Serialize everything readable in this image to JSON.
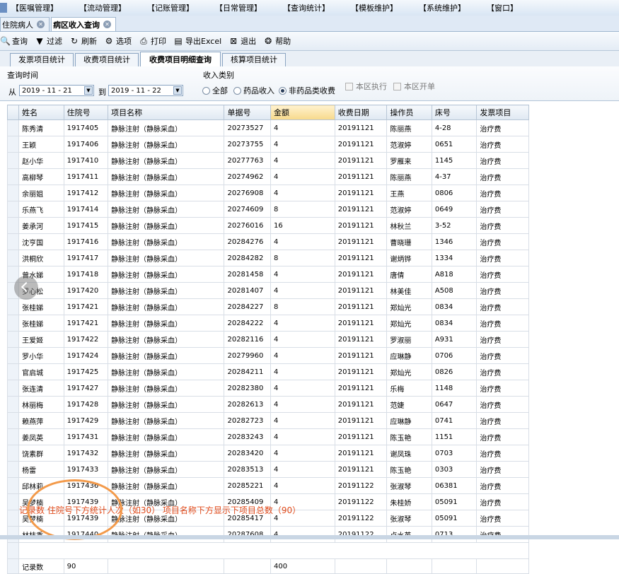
{
  "menu": [
    "【医嘱管理】",
    "【流动管理】",
    "【记账管理】",
    "【日常管理】",
    "【查询统计】",
    "【模板维护】",
    "【系统维护】",
    "【窗口】"
  ],
  "doc_tabs": [
    {
      "label": "住院病人",
      "active": false
    },
    {
      "label": "病区收入查询",
      "active": true
    }
  ],
  "toolbar": [
    {
      "label": "查询",
      "icon": "search-icon"
    },
    {
      "label": "过滤",
      "icon": "filter-icon"
    },
    {
      "label": "刷新",
      "icon": "refresh-icon"
    },
    {
      "label": "选项",
      "icon": "options-icon"
    },
    {
      "label": "打印",
      "icon": "print-icon"
    },
    {
      "label": "导出Excel",
      "icon": "export-excel-icon"
    },
    {
      "label": "退出",
      "icon": "exit-icon"
    },
    {
      "label": "帮助",
      "icon": "help-icon"
    }
  ],
  "sub_tabs": [
    {
      "label": "发票项目统计",
      "active": false
    },
    {
      "label": "收费项目统计",
      "active": false
    },
    {
      "label": "收费项目明细查询",
      "active": true
    },
    {
      "label": "核算项目统计",
      "active": false
    }
  ],
  "filter": {
    "time_label": "查询时间",
    "from_label": "从",
    "from_date": "2019 - 11 - 21",
    "to_label": "到",
    "to_date": "2019 - 11 - 22",
    "income_label": "收入类别",
    "options": [
      "全部",
      "药品收入",
      "非药品类收费"
    ],
    "selected": "非药品类收费",
    "check1": "本区执行",
    "check2": "本区开单"
  },
  "columns": [
    "姓名",
    "住院号",
    "项目名称",
    "单据号",
    "金额",
    "收费日期",
    "操作员",
    "床号",
    "发票项目"
  ],
  "rows": [
    [
      "陈秀清",
      "1917405",
      "静脉注射（静脉采血）",
      "20273527",
      "4",
      "20191121",
      "陈丽燕",
      "4-28",
      "治疗费"
    ],
    [
      "王颖",
      "1917406",
      "静脉注射（静脉采血）",
      "20273755",
      "4",
      "20191121",
      "范淑婷",
      "0651",
      "治疗费"
    ],
    [
      "赵小华",
      "1917410",
      "静脉注射（静脉采血）",
      "20277763",
      "4",
      "20191121",
      "罗雁来",
      "1145",
      "治疗费"
    ],
    [
      "高柳琴",
      "1917411",
      "静脉注射（静脉采血）",
      "20274962",
      "4",
      "20191121",
      "陈丽燕",
      "4-37",
      "治疗费"
    ],
    [
      "余丽姐",
      "1917412",
      "静脉注射（静脉采血）",
      "20276908",
      "4",
      "20191121",
      "王燕",
      "0806",
      "治疗费"
    ],
    [
      "乐燕飞",
      "1917414",
      "静脉注射（静脉采血）",
      "20274609",
      "8",
      "20191121",
      "范淑婷",
      "0649",
      "治疗费"
    ],
    [
      "姜承河",
      "1917415",
      "静脉注射（静脉采血）",
      "20276016",
      "16",
      "20191121",
      "林秋兰",
      "3-52",
      "治疗费"
    ],
    [
      "沈亨国",
      "1917416",
      "静脉注射（静脉采血）",
      "20284276",
      "4",
      "20191121",
      "曹晓珊",
      "1346",
      "治疗费"
    ],
    [
      "洪桐欣",
      "1917417",
      "静脉注射（静脉采血）",
      "20284282",
      "8",
      "20191121",
      "谢炳铧",
      "1334",
      "治疗费"
    ],
    [
      "曾水娣",
      "1917418",
      "静脉注射（静脉采血）",
      "20281458",
      "4",
      "20191121",
      "唐倩",
      "A818",
      "治疗费"
    ],
    [
      "罗心松",
      "1917420",
      "静脉注射（静脉采血）",
      "20281407",
      "4",
      "20191121",
      "林美佳",
      "A508",
      "治疗费"
    ],
    [
      "张桂娣",
      "1917421",
      "静脉注射（静脉采血）",
      "20284227",
      "8",
      "20191121",
      "郑灿光",
      "0834",
      "治疗费"
    ],
    [
      "张桂娣",
      "1917421",
      "静脉注射（静脉采血）",
      "20284222",
      "4",
      "20191121",
      "郑灿光",
      "0834",
      "治疗费"
    ],
    [
      "王爱姬",
      "1917422",
      "静脉注射（静脉采血）",
      "20282116",
      "4",
      "20191121",
      "罗淑丽",
      "A931",
      "治疗费"
    ],
    [
      "罗小华",
      "1917424",
      "静脉注射（静脉采血）",
      "20279960",
      "4",
      "20191121",
      "应琳静",
      "0706",
      "治疗费"
    ],
    [
      "官启城",
      "1917425",
      "静脉注射（静脉采血）",
      "20284211",
      "4",
      "20191121",
      "郑灿光",
      "0826",
      "治疗费"
    ],
    [
      "张连清",
      "1917427",
      "静脉注射（静脉采血）",
      "20282380",
      "4",
      "20191121",
      "乐梅",
      "1148",
      "治疗费"
    ],
    [
      "林丽梅",
      "1917428",
      "静脉注射（静脉采血）",
      "20282613",
      "4",
      "20191121",
      "范婕",
      "0647",
      "治疗费"
    ],
    [
      "赖燕萍",
      "1917429",
      "静脉注射（静脉采血）",
      "20282723",
      "4",
      "20191121",
      "应琳静",
      "0741",
      "治疗费"
    ],
    [
      "姜凤英",
      "1917431",
      "静脉注射（静脉采血）",
      "20283243",
      "4",
      "20191121",
      "陈玉艳",
      "1151",
      "治疗费"
    ],
    [
      "饶素群",
      "1917432",
      "静脉注射（静脉采血）",
      "20283420",
      "4",
      "20191121",
      "谢凤珠",
      "0703",
      "治疗费"
    ],
    [
      "杨雷",
      "1917433",
      "静脉注射（静脉采血）",
      "20283513",
      "4",
      "20191121",
      "陈玉艳",
      "0303",
      "治疗费"
    ],
    [
      "邱林莉",
      "1917436",
      "静脉注射（静脉采血）",
      "20285221",
      "4",
      "20191122",
      "张淑琴",
      "06381",
      "治疗费"
    ],
    [
      "吴梦楠",
      "1917439",
      "静脉注射（静脉采血）",
      "20285409",
      "4",
      "20191122",
      "朱桂娇",
      "05091",
      "治疗费"
    ],
    [
      "吴梦楠",
      "1917439",
      "静脉注射（静脉采血）",
      "20285417",
      "4",
      "20191122",
      "张淑琴",
      "05091",
      "治疗费"
    ],
    [
      "林枝香",
      "1917440",
      "静脉注射（静脉采血）",
      "20287608",
      "4",
      "20191122",
      "卢水英",
      "0713",
      "治疗费"
    ]
  ],
  "footer": {
    "label": "记录数",
    "count": "90",
    "amount": "400"
  },
  "annotation": "记录数  住院号下方统计人次（如30）   项目名称下方显示下项目总数（90）",
  "colors": {
    "annotation": "#e04a1a",
    "circle": "#f39a4a"
  }
}
